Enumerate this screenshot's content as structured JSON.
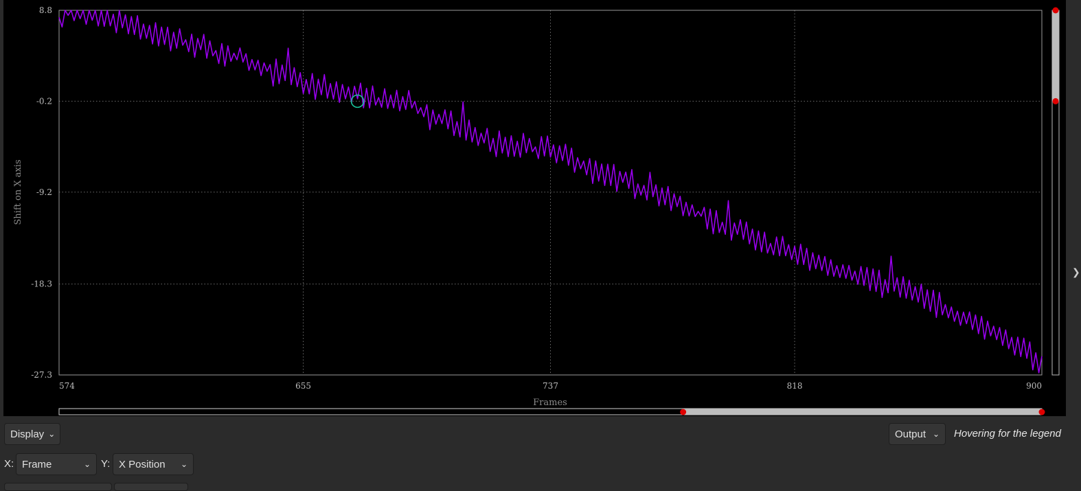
{
  "chart_data": {
    "type": "line",
    "xlabel": "Frames",
    "ylabel": "Shift on X axis",
    "xlim": [
      574,
      900
    ],
    "ylim": [
      -27.3,
      8.8
    ],
    "x_ticks": [
      "574",
      "655",
      "737",
      "818",
      "900"
    ],
    "y_ticks": [
      "8.8",
      "-0.2",
      "-9.2",
      "-18.3",
      "-27.3"
    ],
    "grid": true,
    "series": [
      {
        "color": "#9900ee",
        "x_start": 574,
        "x_end": 900,
        "keypoints": [
          [
            574,
            7.5
          ],
          [
            577,
            8.8
          ],
          [
            595,
            7.6
          ],
          [
            610,
            6.0
          ],
          [
            625,
            4.8
          ],
          [
            640,
            3.3
          ],
          [
            655,
            1.6
          ],
          [
            667,
            0.8
          ],
          [
            673,
            0.3
          ],
          [
            690,
            -0.5
          ],
          [
            705,
            -2.7
          ],
          [
            720,
            -4.5
          ],
          [
            737,
            -5.0
          ],
          [
            750,
            -6.8
          ],
          [
            765,
            -8.5
          ],
          [
            780,
            -10.5
          ],
          [
            795,
            -12.5
          ],
          [
            810,
            -14.5
          ],
          [
            825,
            -16.0
          ],
          [
            840,
            -17.5
          ],
          [
            855,
            -18.8
          ],
          [
            870,
            -21.0
          ],
          [
            885,
            -23.2
          ],
          [
            900,
            -26.0
          ]
        ]
      }
    ],
    "marker": {
      "x": 673,
      "y": -0.2,
      "color": "#19c49a"
    },
    "x_range_handles": [
      781,
      900
    ],
    "y_range_handles": [
      8.8,
      -0.2
    ]
  },
  "toolbar": {
    "display_label": "Display",
    "output_label": "Output",
    "legend_hint": "Hovering for the legend",
    "x_label": "X:",
    "x_value": "Frame",
    "y_label": "Y:",
    "y_value": "X Position"
  },
  "icons": {
    "collapse": "chevron-right-icon",
    "dropdown": "chevron-down-icon"
  }
}
